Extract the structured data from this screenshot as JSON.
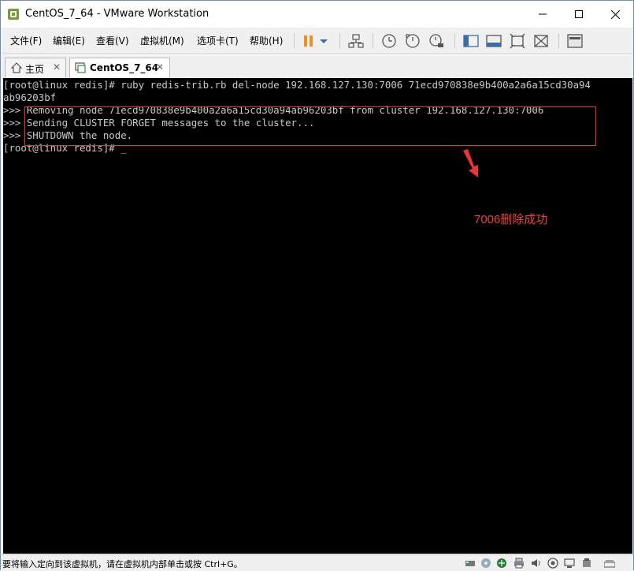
{
  "window": {
    "title": "CentOS_7_64 - VMware Workstation"
  },
  "menu": {
    "items": [
      "文件(F)",
      "编辑(E)",
      "查看(V)",
      "虚拟机(M)",
      "选项卡(T)",
      "帮助(H)"
    ]
  },
  "tabs": [
    {
      "label": "主页",
      "icon": "home-icon",
      "active": false
    },
    {
      "label": "CentOS_7_64",
      "icon": "vm-icon",
      "active": true
    }
  ],
  "terminal": {
    "lines": [
      "[root@linux redis]# ruby redis-trib.rb del-node 192.168.127.130:7006 71ecd970838e9b400a2a6a15cd30a94",
      "ab96203bf",
      ">>> Removing node 71ecd970838e9b400a2a6a15cd30a94ab96203bf from cluster 192.168.127.130:7006",
      ">>> Sending CLUSTER FORGET messages to the cluster...",
      ">>> SHUTDOWN the node.",
      "[root@linux redis]# _"
    ]
  },
  "annotation": {
    "text": "7006删除成功",
    "color": "#f04040"
  },
  "status": {
    "text": "要将输入定向到该虚拟机，请在虚拟机内部单击或按 Ctrl+G。"
  },
  "colors": {
    "accent": "#e8353a",
    "pause": "#e8902a",
    "terminal_bg": "#000000"
  }
}
